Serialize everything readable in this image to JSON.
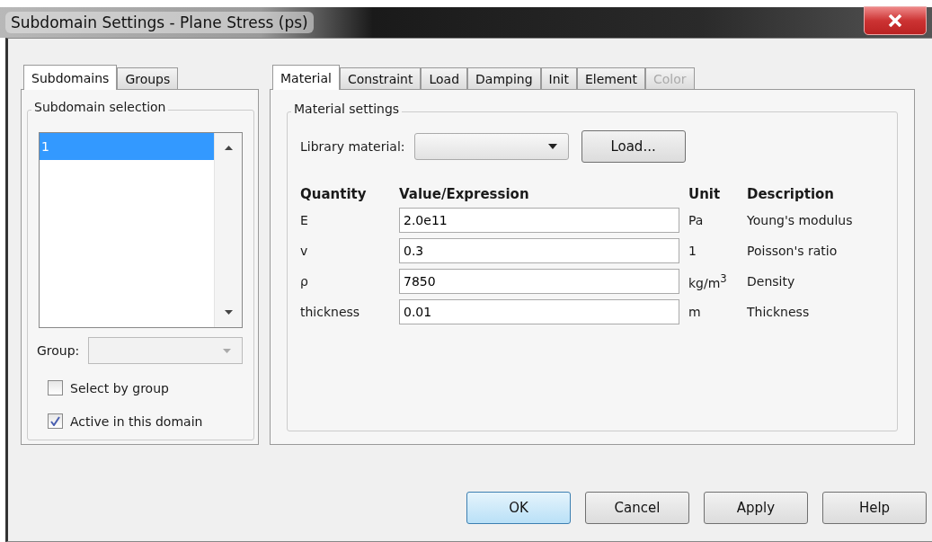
{
  "window": {
    "title": "Subdomain Settings - Plane Stress (ps)"
  },
  "left_tabs": [
    {
      "label": "Subdomains",
      "selected": true
    },
    {
      "label": "Groups",
      "selected": false
    }
  ],
  "subdomain_selection": {
    "label": "Subdomain selection",
    "items": [
      {
        "label": "1",
        "selected": true
      }
    ]
  },
  "group": {
    "label": "Group:"
  },
  "checkboxes": [
    {
      "label": "Select by group",
      "checked": false
    },
    {
      "label": "Active in this domain",
      "checked": true
    }
  ],
  "right_tabs": [
    {
      "label": "Material",
      "selected": true,
      "disabled": false
    },
    {
      "label": "Constraint",
      "selected": false,
      "disabled": false
    },
    {
      "label": "Load",
      "selected": false,
      "disabled": false
    },
    {
      "label": "Damping",
      "selected": false,
      "disabled": false
    },
    {
      "label": "Init",
      "selected": false,
      "disabled": false
    },
    {
      "label": "Element",
      "selected": false,
      "disabled": false
    },
    {
      "label": "Color",
      "selected": false,
      "disabled": true
    }
  ],
  "material_settings": {
    "title": "Material settings",
    "library_label": "Library material:",
    "load_button": "Load..."
  },
  "table": {
    "columns": [
      "Quantity",
      "Value/Expression",
      "Unit",
      "Description"
    ],
    "rows": [
      {
        "quantity": "E",
        "value": "2.0e11",
        "unit": "Pa",
        "description": "Young's modulus"
      },
      {
        "quantity": "v",
        "value": "0.3",
        "unit": "1",
        "description": "Poisson's ratio"
      },
      {
        "quantity": "ρ",
        "value": "7850",
        "unit": "kg/m$^{3}$",
        "description": "Density"
      },
      {
        "quantity": "thickness",
        "value": "0.01",
        "unit": "m",
        "description": "Thickness"
      }
    ]
  },
  "buttons": [
    {
      "label": "OK",
      "default": true
    },
    {
      "label": "Cancel",
      "default": false
    },
    {
      "label": "Apply",
      "default": false
    },
    {
      "label": "Help",
      "default": false
    }
  ]
}
